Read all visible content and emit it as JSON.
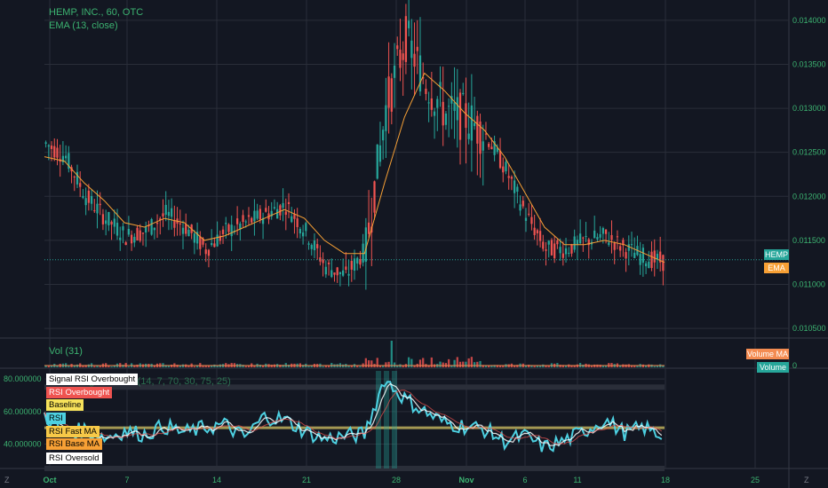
{
  "header": {
    "symbol": "HEMP, INC., 60, OTC",
    "ema_label": "EMA (13, close)",
    "vol_label": "Vol (31)",
    "rsi_label": "RSI Swing Indicator (14, 7, 70, 30, 75, 25)"
  },
  "colors": {
    "bg": "#131722",
    "grid": "#2a2e39",
    "up": "#26a69a",
    "down": "#ef5350",
    "ema": "#f7a035",
    "text": "#b2b5be",
    "accent_green": "#3cb371",
    "rsi_line": "#4dd0e1",
    "rsi_fast": "#ffffff",
    "baseline": "#c8b960",
    "band": "#2a2e39"
  },
  "price_axis": {
    "ticks": [
      "0.014000",
      "0.013500",
      "0.013000",
      "0.012500",
      "0.012000",
      "0.011500",
      "0.011000",
      "0.010500"
    ],
    "current_tag": "HEMP",
    "ema_tag": "EMA",
    "volume_ma_tag": "Volume MA",
    "volume_tag": "Volume",
    "volume_zero": "0"
  },
  "rsi_axis": {
    "ticks": [
      "80.000000",
      "60.000000",
      "40.000000"
    ]
  },
  "rsi_legend": {
    "signal_overbought": "Signal RSI Overbought",
    "overbought": "RSI Overbought",
    "baseline": "Baseline",
    "rsi": "RSI",
    "fast": "RSI Fast MA",
    "base": "RSI Base MA",
    "oversold": "RSI Oversold"
  },
  "time_axis": {
    "labels": [
      "Oct",
      "7",
      "14",
      "21",
      "28",
      "Nov",
      "6",
      "11",
      "18",
      "25"
    ]
  },
  "corner_labels": {
    "left": "Z",
    "right": "Z"
  },
  "chart_data": [
    {
      "type": "candlestick",
      "title": "HEMP, INC., 60, OTC",
      "series": [
        {
          "name": "EMA (13, close)",
          "values": [
            0.01245,
            0.0124,
            0.01215,
            0.01195,
            0.0117,
            0.01165,
            0.01175,
            0.0117,
            0.0115,
            0.01155,
            0.01165,
            0.01175,
            0.01185,
            0.01175,
            0.0115,
            0.01135,
            0.01135,
            0.01215,
            0.0129,
            0.0134,
            0.0132,
            0.01295,
            0.01275,
            0.01245,
            0.01205,
            0.01165,
            0.01145,
            0.01145,
            0.0115,
            0.01145,
            0.01135,
            0.01125
          ]
        }
      ],
      "approx_closes": [
        0.0126,
        0.01245,
        0.012,
        0.01175,
        0.01155,
        0.0116,
        0.0118,
        0.01165,
        0.0114,
        0.0116,
        0.0117,
        0.0118,
        0.0119,
        0.0116,
        0.0112,
        0.0111,
        0.0114,
        0.013,
        0.0138,
        0.0133,
        0.01295,
        0.0129,
        0.0127,
        0.0123,
        0.0118,
        0.0114,
        0.0114,
        0.0115,
        0.01155,
        0.0114,
        0.0113,
        0.01125
      ],
      "ylim": [
        0.0104,
        0.01415
      ],
      "last_price": 0.01128
    },
    {
      "type": "bar",
      "title": "Vol (31)",
      "note_spike_index": 17
    },
    {
      "type": "line",
      "title": "RSI Swing Indicator (14, 7, 70, 30, 75, 25)",
      "ylim": [
        25,
        85
      ],
      "levels": {
        "overbought": 75,
        "baseline": 50,
        "oversold": 25,
        "signal_overbought": 70
      },
      "series": [
        {
          "name": "RSI",
          "values": [
            58,
            46,
            49,
            44,
            48,
            46,
            51,
            47,
            50,
            52,
            44,
            57,
            55,
            48,
            43,
            45,
            46,
            80,
            68,
            60,
            53,
            51,
            49,
            42,
            45,
            38,
            42,
            48,
            55,
            47,
            50,
            44
          ]
        }
      ]
    }
  ]
}
